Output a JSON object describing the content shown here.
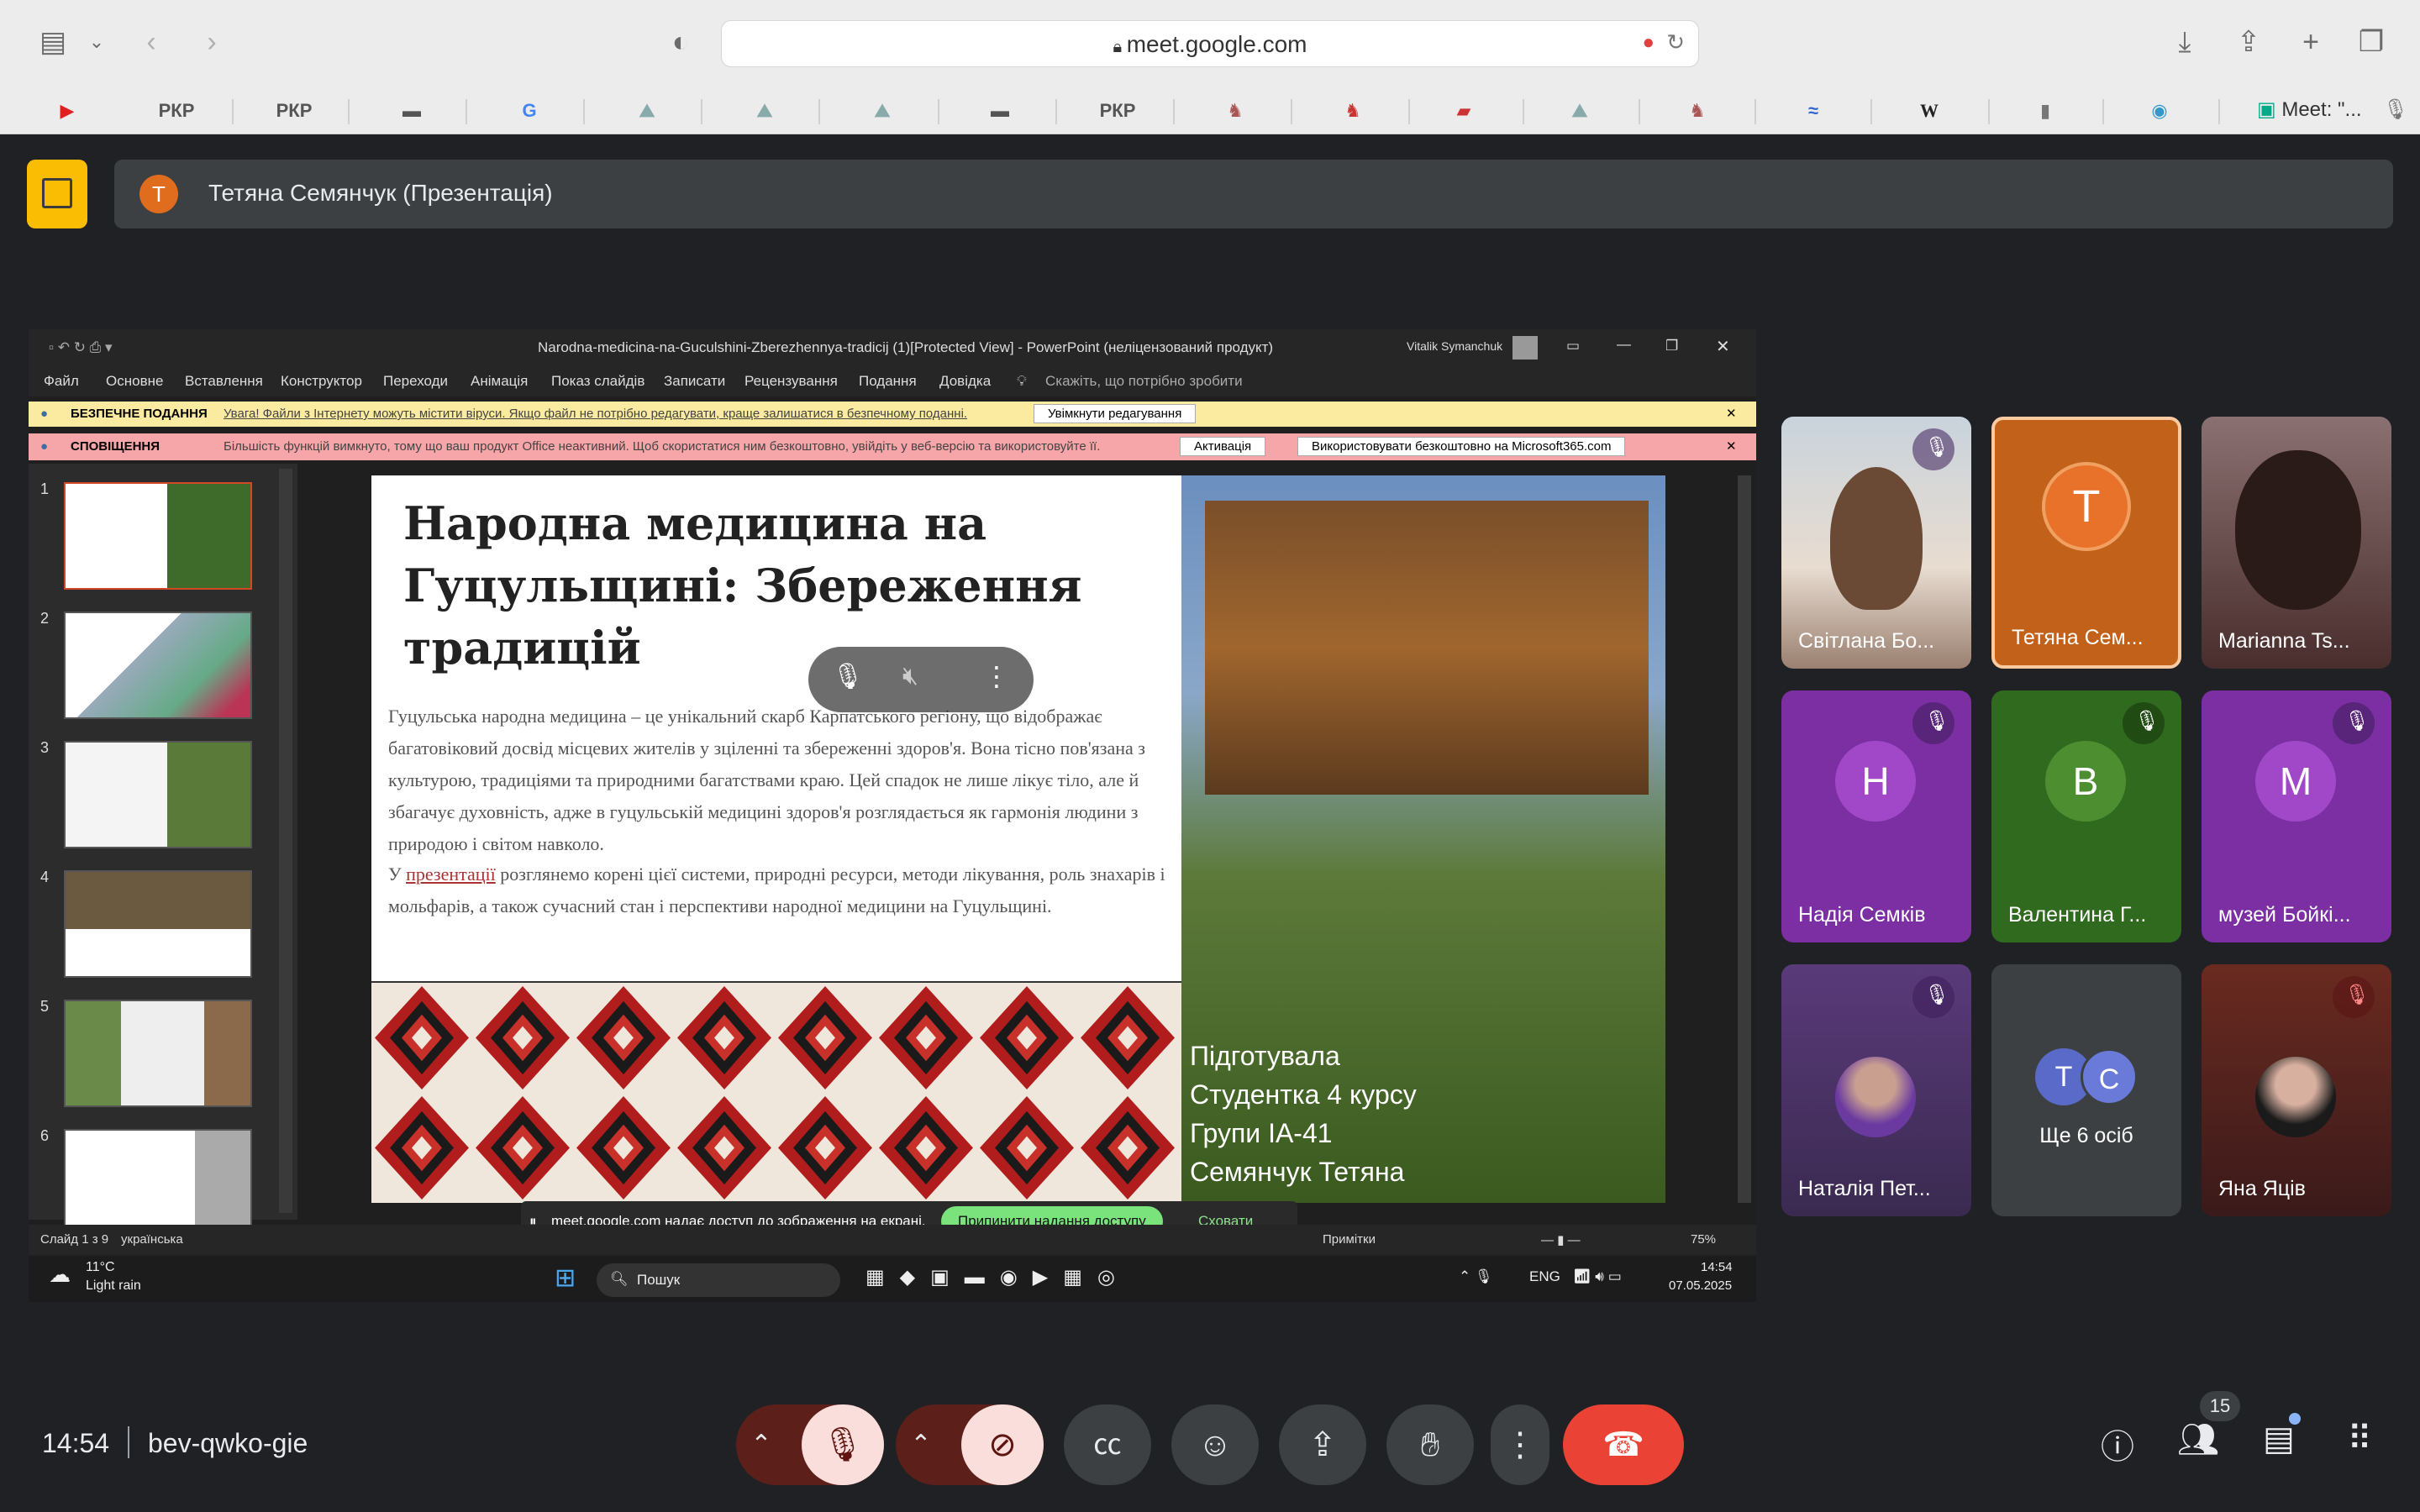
{
  "browser": {
    "url": "meet.google.com",
    "bookmarks": [
      "РКР",
      "РКР",
      "РКР"
    ],
    "google_letter": "G",
    "wiki_letter": "W",
    "last_tab": "Meet: \"..."
  },
  "presenter": {
    "avatar_letter": "Т",
    "label": "Тетяна Семянчук (Презентація)"
  },
  "ppt": {
    "window_title": "Narodna-medicina-na-Guculshini-Zberezhennya-tradicij (1)[Protected View]  -  PowerPoint (неліцензований продукт)",
    "user": "Vitalik Symanchuk",
    "menu": [
      "Файл",
      "Основне",
      "Вставлення",
      "Конструктор",
      "Переходи",
      "Анімація",
      "Показ слайдів",
      "Записати",
      "Рецензування",
      "Подання",
      "Довідка"
    ],
    "tell_me": "Скажіть, що потрібно зробити",
    "warn1_label": "БЕЗПЕЧНЕ ПОДАННЯ",
    "warn1_text": "Увага! Файли з Інтернету можуть містити віруси. Якщо файл не потрібно редагувати, краще залишатися в безпечному поданні.",
    "warn1_btn": "Увімкнути редагування",
    "warn2_label": "СПОВІЩЕННЯ",
    "warn2_text": "Більшість функцій вимкнуто, тому що ваш продукт Office неактивний. Щоб скористатися ним безкоштовно, увійдіть у веб-версію та використовуйте її.",
    "warn2_btn1": "Активація",
    "warn2_btn2": "Використовувати безкоштовно на Microsoft365.com",
    "thumb_nums": [
      "1",
      "2",
      "3",
      "4",
      "5",
      "6"
    ],
    "slide_title": "Народна медицина на Гуцульщині: Збереження традицій",
    "slide_body": "Гуцульська народна медицина – це унікальний скарб Карпатського регіону, що відображає багатовіковий досвід місцевих жителів у зціленні та збереженні здоров'я. Вона тісно пов'язана з культурою, традиціями та природними багатствами краю. Цей спадок не лише лікує тіло, але й збагачує духовність, адже в гуцульській медицині здоров'я розглядається як гармонія людини з природою і світом навколо.",
    "slide_body2_pre": "У ",
    "slide_body2_link": "презентації",
    "slide_body2_post": " розглянемо корені цієї системи, природні ресурси, методи лікування, роль знахарів і мольфарів, а також сучасний стан і перспективи народної медицини на Гуцульщині.",
    "caption": [
      "Підготувала",
      "Студентка 4 курсу",
      "Групи ІА-41",
      "Семянчук Тетяна"
    ],
    "status_slide": "Слайд 1 з 9",
    "status_lang": "українська",
    "notes": "Примітки",
    "zoom": "75%",
    "weather_temp": "11°C",
    "weather_desc": "Light rain",
    "search": "Пошук",
    "lang": "ENG",
    "time": "14:54",
    "date": "07.05.2025",
    "share_msg": "meet.google.com надає доступ до зображення на екрані.",
    "share_stop": "Припинити надання доступу",
    "share_hide": "Сховати"
  },
  "tiles": [
    {
      "name": "Світлана Бо...",
      "type": "video",
      "muted": true
    },
    {
      "name": "Тетяна Сем...",
      "letter": "Т",
      "color": "#e06c1e",
      "muted": false
    },
    {
      "name": "Marianna Ts...",
      "type": "video",
      "muted": false
    },
    {
      "name": "Надія Семків",
      "letter": "Н",
      "color": "#9c3fc1",
      "muted": true
    },
    {
      "name": "Валентина Г...",
      "letter": "В",
      "color": "#4c8f2f",
      "muted": true
    },
    {
      "name": "музей Бойкі...",
      "letter": "М",
      "color": "#9c3fc1",
      "muted": true
    },
    {
      "name": "Наталія Пет...",
      "type": "photo",
      "muted": true
    },
    {
      "name": "Ще 6 осіб",
      "letters": [
        "Т",
        "С"
      ],
      "muted": false
    },
    {
      "name": "Яна Яців",
      "type": "photo",
      "muted": true
    }
  ],
  "bottom": {
    "time": "14:54",
    "code": "bev-qwko-gie",
    "people_count": "15"
  }
}
